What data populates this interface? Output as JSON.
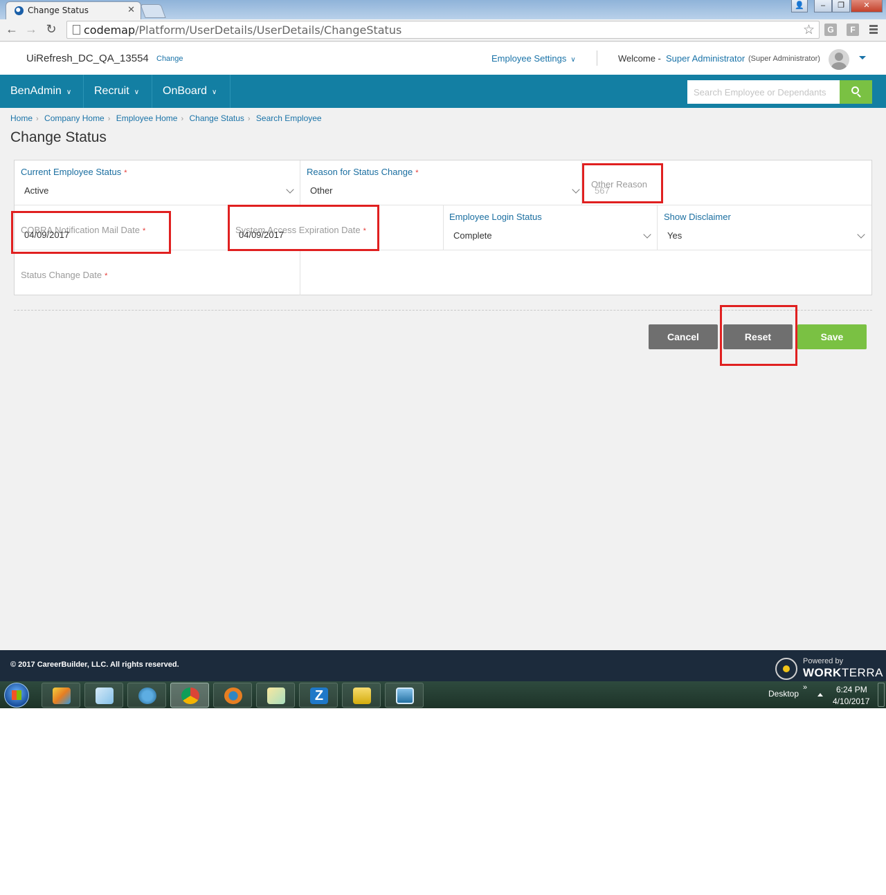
{
  "browser": {
    "tab_title": "Change Status",
    "url_host": "codemap",
    "url_path": "/Platform/UserDetails/UserDetails/ChangeStatus",
    "ext1": "G",
    "ext2": "F"
  },
  "header": {
    "company": "UiRefresh_DC_QA_13554",
    "change_link": "Change",
    "employee_settings": "Employee Settings",
    "welcome": "Welcome -",
    "user_name": "Super Administrator",
    "user_role": "(Super Administrator)"
  },
  "nav": {
    "items": [
      {
        "label": "BenAdmin"
      },
      {
        "label": "Recruit"
      },
      {
        "label": "OnBoard"
      }
    ],
    "search_placeholder": "Search Employee or Dependants"
  },
  "breadcrumb": [
    "Home",
    "Company Home",
    "Employee Home",
    "Change Status",
    "Search Employee"
  ],
  "page_title": "Change Status",
  "form": {
    "current_status_label": "Current Employee Status",
    "current_status_value": "Active",
    "reason_label": "Reason for Status Change",
    "reason_value": "Other",
    "other_reason_label": "Other Reason",
    "other_reason_value": "567",
    "cobra_label": "COBRA Notification Mail Date",
    "cobra_value": "04/09/2017",
    "access_exp_label": "System Access Expiration Date",
    "access_exp_value": "04/09/2017",
    "login_status_label": "Employee Login Status",
    "login_status_value": "Complete",
    "disclaimer_label": "Show Disclaimer",
    "disclaimer_value": "Yes",
    "status_change_date_label": "Status Change Date",
    "required_mark": "*"
  },
  "buttons": {
    "cancel": "Cancel",
    "reset": "Reset",
    "save": "Save"
  },
  "footer": {
    "copyright": "© 2017 CareerBuilder, LLC. All rights reserved.",
    "powered_by": "Powered by",
    "brand_bold": "WORK",
    "brand_rest": "TERRA"
  },
  "taskbar": {
    "desktop": "Desktop",
    "chevrons": "»",
    "time": "6:24 PM",
    "date": "4/10/2017",
    "z_label": "Z"
  },
  "colors": {
    "nav_bg": "#137fa3",
    "accent_link": "#1a73a8",
    "save_green": "#7ac143",
    "highlight_red": "#e02020"
  }
}
